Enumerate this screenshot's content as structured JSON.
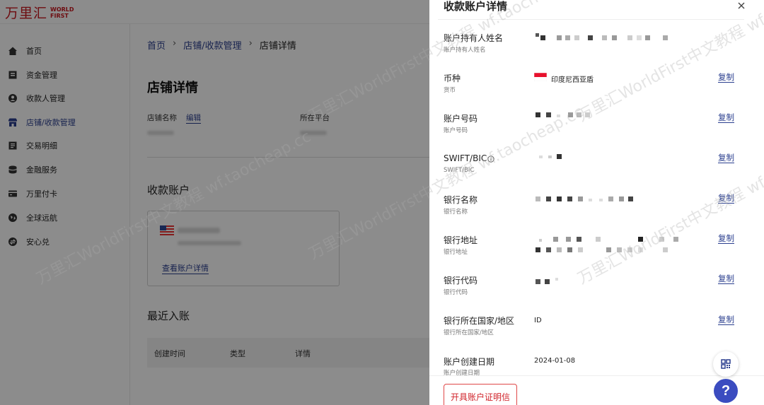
{
  "logo": {
    "cn": "万里汇",
    "en_line1": "WORLD",
    "en_line2": "FIRST"
  },
  "sidebar": {
    "items": [
      {
        "label": "首页",
        "icon": "home-icon"
      },
      {
        "label": "资金管理",
        "icon": "wallet-icon"
      },
      {
        "label": "收款人管理",
        "icon": "user-icon"
      },
      {
        "label": "店铺/收款管理",
        "icon": "store-icon",
        "active": true
      },
      {
        "label": "交易明细",
        "icon": "list-icon"
      },
      {
        "label": "金融服务",
        "icon": "coins-icon"
      },
      {
        "label": "万里付卡",
        "icon": "card-icon"
      },
      {
        "label": "全球远航",
        "icon": "globe-icon"
      },
      {
        "label": "安心兑",
        "icon": "exchange-icon"
      }
    ]
  },
  "breadcrumb": {
    "home": "首页",
    "sep": "›",
    "parent": "店铺/收款管理",
    "current": "店铺详情"
  },
  "store": {
    "title": "店铺详情",
    "name_label": "店铺名称",
    "edit_label": "编辑",
    "platform_label": "所在平台",
    "accounts_title": "收款账户",
    "view_account": "查看账户详情",
    "recent_title": "最近入账",
    "table_headers": [
      "创建时间",
      "类型",
      "详情"
    ]
  },
  "drawer": {
    "title": "收款账户详情",
    "close_icon": "close-icon",
    "copy_label": "复制",
    "fields": [
      {
        "label": "账户持有人姓名",
        "sub": "账户持有人姓名",
        "value": ""
      },
      {
        "label": "币种",
        "sub": "货币",
        "value": "印度尼西亚盾",
        "flag": "indonesia-flag-icon"
      },
      {
        "label": "账户号码",
        "sub": "账户号码",
        "value": ""
      },
      {
        "label": "SWIFT/BIC",
        "sub": "SWIFT/BIC",
        "value": "",
        "info_icon": "info-icon"
      },
      {
        "label": "银行名称",
        "sub": "银行名称",
        "value": ""
      },
      {
        "label": "银行地址",
        "sub": "银行地址",
        "value": ""
      },
      {
        "label": "银行代码",
        "sub": "银行代码",
        "value": ""
      },
      {
        "label": "银行所在国家/地区",
        "sub": "银行所在国家/地区",
        "value": "ID"
      },
      {
        "label": "账户创建日期",
        "sub": "账户创建日期",
        "value": "2024-01-08"
      }
    ],
    "cert_button": "开具账户证明信",
    "help_label": "?"
  },
  "watermark": "万里汇WorldFirst中文教程 wf.taocheap.cc",
  "colors": {
    "brand_red": "#c8161e",
    "link_blue": "#2b3f8f",
    "help_blue": "#3b4cc0"
  }
}
